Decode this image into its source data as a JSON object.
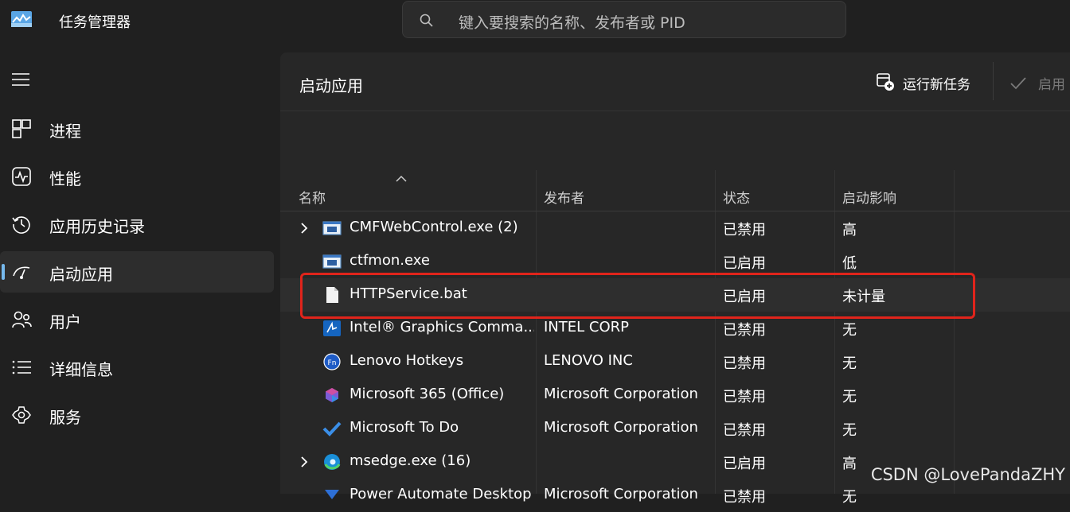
{
  "app": {
    "title": "任务管理器",
    "logo": "task-manager-logo"
  },
  "search": {
    "placeholder": "键入要搜索的名称、发布者或 PID",
    "icon": "search-icon"
  },
  "sidebar": {
    "menu_icon": "hamburger-icon",
    "items": [
      {
        "label": "进程",
        "icon": "processes-icon",
        "active": false
      },
      {
        "label": "性能",
        "icon": "performance-icon",
        "active": false
      },
      {
        "label": "应用历史记录",
        "icon": "history-icon",
        "active": false
      },
      {
        "label": "启动应用",
        "icon": "startup-icon",
        "active": true
      },
      {
        "label": "用户",
        "icon": "users-icon",
        "active": false
      },
      {
        "label": "详细信息",
        "icon": "details-icon",
        "active": false
      },
      {
        "label": "服务",
        "icon": "services-icon",
        "active": false
      }
    ]
  },
  "page": {
    "title": "启动应用",
    "run_task_label": "运行新任务",
    "enable_label": "启用"
  },
  "table": {
    "columns": {
      "name": "名称",
      "publisher": "发布者",
      "status": "状态",
      "impact": "启动影响"
    },
    "sort": "ascending",
    "rows": [
      {
        "name": "CMFWebControl.exe (2)",
        "publisher": "",
        "status": "已禁用",
        "impact": "高",
        "expandable": true,
        "icon": "window-app-icon"
      },
      {
        "name": "ctfmon.exe",
        "publisher": "",
        "status": "已启用",
        "impact": "低",
        "expandable": false,
        "icon": "window-app-icon"
      },
      {
        "name": "HTTPService.bat",
        "publisher": "",
        "status": "已启用",
        "impact": "未计量",
        "expandable": false,
        "icon": "file-icon",
        "selected": true
      },
      {
        "name": "Intel® Graphics Comma...",
        "publisher": "INTEL CORP",
        "status": "已禁用",
        "impact": "无",
        "expandable": false,
        "icon": "intel-graphics-icon"
      },
      {
        "name": "Lenovo Hotkeys",
        "publisher": "LENOVO INC",
        "status": "已禁用",
        "impact": "无",
        "expandable": false,
        "icon": "lenovo-fn-icon"
      },
      {
        "name": "Microsoft 365 (Office)",
        "publisher": "Microsoft Corporation",
        "status": "已禁用",
        "impact": "无",
        "expandable": false,
        "icon": "office-icon"
      },
      {
        "name": "Microsoft To Do",
        "publisher": "Microsoft Corporation",
        "status": "已禁用",
        "impact": "无",
        "expandable": false,
        "icon": "todo-check-icon"
      },
      {
        "name": "msedge.exe (16)",
        "publisher": "",
        "status": "已启用",
        "impact": "高",
        "expandable": true,
        "icon": "edge-icon"
      },
      {
        "name": "Power Automate Desktop",
        "publisher": "Microsoft Corporation",
        "status": "已禁用",
        "impact": "无",
        "expandable": false,
        "icon": "power-automate-icon"
      }
    ]
  },
  "watermark": "CSDN @LovePandaZHY",
  "colors": {
    "accent": "#76b9ed",
    "highlight_border": "#e0241b",
    "background": "#202020",
    "panel": "#272727"
  }
}
